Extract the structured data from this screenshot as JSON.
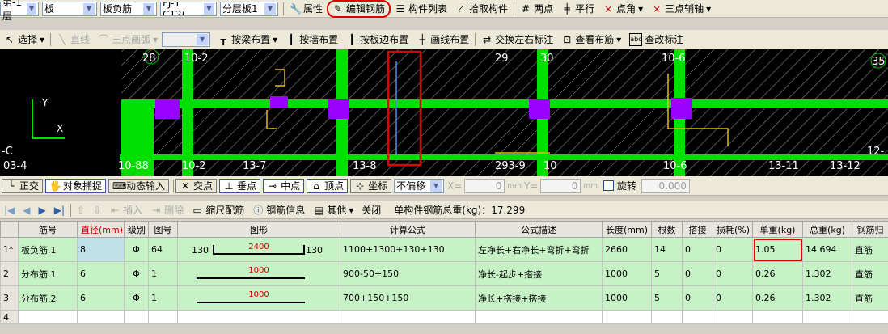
{
  "toolbar1": {
    "floor": "第-1层",
    "category": "板",
    "subcategory": "板负筋",
    "component": "FJ-1 C12(",
    "layer": "分层板1",
    "btn_property": "属性",
    "btn_edit_rebar": "编辑钢筋",
    "btn_component_list": "构件列表",
    "btn_pick": "拾取构件",
    "btn_two_points": "两点",
    "btn_parallel": "平行",
    "btn_point_angle": "点角",
    "btn_three_point_axis": "三点辅轴"
  },
  "toolbar2": {
    "select": "选择",
    "line": "直线",
    "arc": "三点画弧",
    "by_beam": "按梁布置",
    "by_wall": "按墙布置",
    "by_slab_edge": "按板边布置",
    "draw_line": "画线布置",
    "swap_label": "交换左右标注",
    "view_layout": "查看布筋",
    "modify_label": "查改标注"
  },
  "canvas": {
    "labels": [
      "28",
      "10-2",
      "29",
      "30",
      "10-6",
      "35",
      "-C",
      "03-4",
      "10-88",
      "10-2",
      "13-7",
      "13-8",
      "293-9",
      "10",
      "10-6",
      "13-11",
      "13-12",
      "12-"
    ],
    "axis_y": "Y",
    "axis_x": "X"
  },
  "statusbar": {
    "ortho": "正交",
    "snap": "对象捕捉",
    "dynamic_input": "动态输入",
    "intersection": "交点",
    "perpendicular": "垂点",
    "midpoint": "中点",
    "vertex": "顶点",
    "coordinate": "坐标",
    "offset_mode": "不偏移",
    "x_label": "X=",
    "x_value": "0",
    "y_label": "Y=",
    "y_value": "0",
    "unit": "mm",
    "rotate": "旋转",
    "rotate_value": "0.000"
  },
  "rebar_toolbar": {
    "insert": "插入",
    "delete": "删除",
    "scale_config": "缩尺配筋",
    "rebar_info": "钢筋信息",
    "other": "其他",
    "close": "关闭",
    "total_weight": "单构件钢筋总重(kg)：17.299"
  },
  "table": {
    "headers": [
      "筋号",
      "直径(mm)",
      "级别",
      "图号",
      "图形",
      "计算公式",
      "公式描述",
      "长度(mm)",
      "根数",
      "搭接",
      "损耗(%)",
      "单重(kg)",
      "总重(kg)",
      "钢筋归"
    ],
    "rows": [
      {
        "num": "1*",
        "name": "板负筋.1",
        "dia": "8",
        "grade": "Φ",
        "fig": "64",
        "shape_left": "130",
        "shape_mid": "2400",
        "shape_right": "130",
        "formula": "1100+1300+130+130",
        "desc": "左净长+右净长+弯折+弯折",
        "length": "2660",
        "count": "14",
        "lap": "0",
        "loss": "0",
        "unit_w": "1.05",
        "total_w": "14.694",
        "type": "直筋"
      },
      {
        "num": "2",
        "name": "分布筋.1",
        "dia": "6",
        "grade": "Φ",
        "fig": "1",
        "shape_left": "",
        "shape_mid": "1000",
        "shape_right": "",
        "formula": "900-50+150",
        "desc": "净长-起步+搭接",
        "length": "1000",
        "count": "5",
        "lap": "0",
        "loss": "0",
        "unit_w": "0.26",
        "total_w": "1.302",
        "type": "直筋"
      },
      {
        "num": "3",
        "name": "分布筋.2",
        "dia": "6",
        "grade": "Φ",
        "fig": "1",
        "shape_left": "",
        "shape_mid": "1000",
        "shape_right": "",
        "formula": "700+150+150",
        "desc": "净长+搭接+搭接",
        "length": "1000",
        "count": "5",
        "lap": "0",
        "loss": "0",
        "unit_w": "0.26",
        "total_w": "1.302",
        "type": "直筋"
      },
      {
        "num": "4",
        "name": "",
        "dia": "",
        "grade": "",
        "fig": "",
        "shape_left": "",
        "shape_mid": "",
        "shape_right": "",
        "formula": "",
        "desc": "",
        "length": "",
        "count": "",
        "lap": "",
        "loss": "",
        "unit_w": "",
        "total_w": "",
        "type": ""
      }
    ]
  },
  "colors": {
    "highlight_red": "#e00000",
    "row_selected": "#c6f2c6",
    "cad_green": "#00e000",
    "cad_purple": "#9900ff"
  }
}
